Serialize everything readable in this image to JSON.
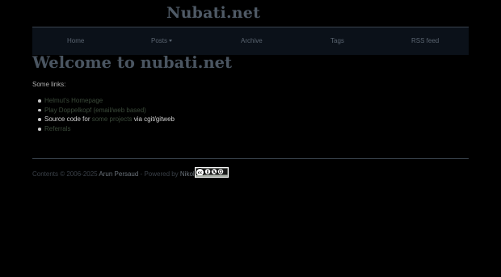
{
  "site": {
    "title": "Nubati.net"
  },
  "nav": {
    "items": [
      "Home",
      "Posts",
      "Archive",
      "Tags",
      "RSS feed"
    ]
  },
  "main": {
    "heading": "Welcome to nubati.net",
    "intro": "Some links:",
    "links": [
      {
        "text": "Helmut's Homepage"
      },
      {
        "text": "Play Doppelkopf (email/web based)"
      },
      {
        "prefix": "Source code for ",
        "link": "some projects",
        "suffix": " via cgit/gitweb"
      },
      {
        "text": "Referrals"
      }
    ]
  },
  "footer": {
    "prefix": "Contents © 2006-2025 ",
    "author": "Arun Persaud",
    "middle": " - Powered by ",
    "powered_by": "Nikola",
    "license_badge": "cc-by-nc-sa"
  },
  "colors": {
    "background": "#000000",
    "navbar_bg": "#0b1119",
    "link": "#3b4a3a",
    "heading": "#4a5561"
  }
}
